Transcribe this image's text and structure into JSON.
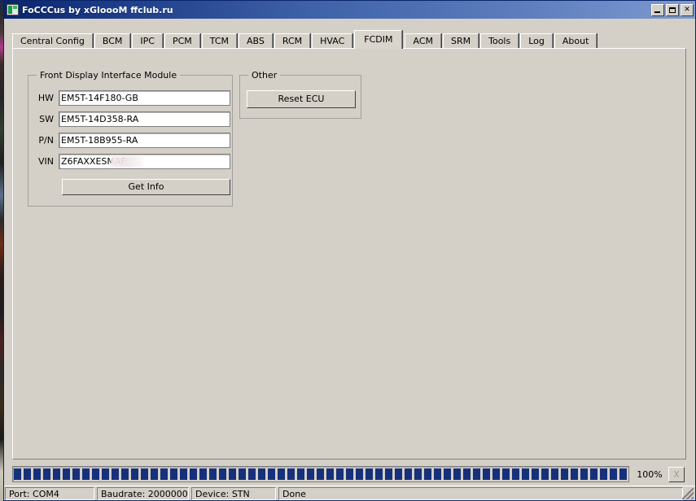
{
  "window": {
    "title": "FoCCCus by xGloooM ffclub.ru",
    "icon": "app-window-icon",
    "caption_buttons": {
      "minimize": "_",
      "maximize": "□",
      "close": "✕"
    }
  },
  "tabs": [
    {
      "label": "Central Config",
      "active": false
    },
    {
      "label": "BCM",
      "active": false
    },
    {
      "label": "IPC",
      "active": false
    },
    {
      "label": "PCM",
      "active": false
    },
    {
      "label": "TCM",
      "active": false
    },
    {
      "label": "ABS",
      "active": false
    },
    {
      "label": "RCM",
      "active": false
    },
    {
      "label": "HVAC",
      "active": false
    },
    {
      "label": "FCDIM",
      "active": true
    },
    {
      "label": "ACM",
      "active": false
    },
    {
      "label": "SRM",
      "active": false
    },
    {
      "label": "Tools",
      "active": false
    },
    {
      "label": "Log",
      "active": false
    },
    {
      "label": "About",
      "active": false
    }
  ],
  "fcdim_panel": {
    "module_group": {
      "title": "Front Display Interface Module",
      "fields": [
        {
          "label": "HW",
          "value": "EM5T-14F180-GB",
          "redacted": false
        },
        {
          "label": "SW",
          "value": "EM5T-14D358-RA",
          "redacted": false
        },
        {
          "label": "P/N",
          "value": "EM5T-18B955-RA",
          "redacted": false
        },
        {
          "label": "VIN",
          "value": "Z6FAXXESMAF",
          "redacted": true
        }
      ],
      "get_info_label": "Get Info"
    },
    "other_group": {
      "title": "Other",
      "reset_ecu_label": "Reset ECU"
    }
  },
  "progress": {
    "percent_label": "100%",
    "percent_value": 100,
    "cancel_label": "X",
    "fill_color": "#16307a"
  },
  "status_bar": {
    "port": "Port: COM4",
    "baudrate": "Baudrate: 2000000",
    "device": "Device: STN",
    "status": "Done"
  },
  "colors": {
    "face": "#d4d0c8",
    "title_active_start": "#0a246a",
    "title_active_end": "#7e9ad0",
    "progress": "#16307a"
  }
}
